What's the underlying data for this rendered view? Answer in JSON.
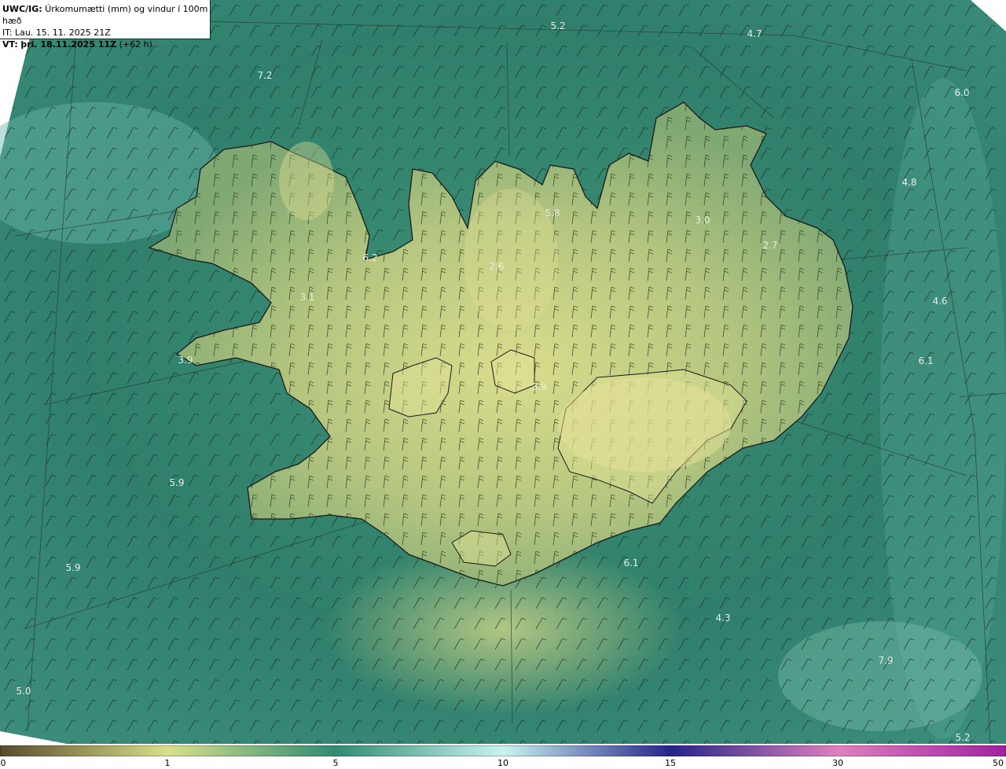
{
  "header": {
    "code": "UWC/IG:",
    "title": "Úrkomumætti (mm) og vindur í 100m hæð",
    "initial_time": "IT: Lau. 15. 11. 2025 21Z",
    "valid_prefix": "VT:",
    "valid_time": "þri. 18.11.2025 11Z",
    "lead": "(+62 h)"
  },
  "value_labels": [
    {
      "id": "v1",
      "text": "5.2"
    },
    {
      "id": "v2",
      "text": "4.7"
    },
    {
      "id": "v3",
      "text": "7.2"
    },
    {
      "id": "v4",
      "text": "6.0"
    },
    {
      "id": "v5",
      "text": "4.8"
    },
    {
      "id": "v6",
      "text": "5.8"
    },
    {
      "id": "v7",
      "text": "3.0"
    },
    {
      "id": "v8",
      "text": "2.7"
    },
    {
      "id": "v9",
      "text": "6.2"
    },
    {
      "id": "v10",
      "text": "2.6"
    },
    {
      "id": "v11",
      "text": "3.1"
    },
    {
      "id": "v12",
      "text": "4.6"
    },
    {
      "id": "v13",
      "text": "3.9"
    },
    {
      "id": "v14",
      "text": "3.9"
    },
    {
      "id": "v15",
      "text": "6.1"
    },
    {
      "id": "v16",
      "text": "5.9"
    },
    {
      "id": "v17",
      "text": "5.9"
    },
    {
      "id": "v18",
      "text": "6.1"
    },
    {
      "id": "v19",
      "text": "4.3"
    },
    {
      "id": "v20",
      "text": "7.9"
    },
    {
      "id": "v21",
      "text": "5.0"
    },
    {
      "id": "v22",
      "text": "5.2"
    }
  ],
  "scale": {
    "ticks": [
      "0",
      "1",
      "5",
      "10",
      "15",
      "30",
      "50"
    ],
    "colors": [
      "#5a4a2a",
      "#d8e08a",
      "#2e8c73",
      "#c8f4f0",
      "#24248a",
      "#e080c0",
      "#a020a0"
    ]
  },
  "colors": {
    "sea": "#2f7f6c",
    "sea_light": "#6ab6a8",
    "land_low": "#8fb07a",
    "land_high": "#d8dc8a",
    "coast": "#1a1a1a"
  }
}
